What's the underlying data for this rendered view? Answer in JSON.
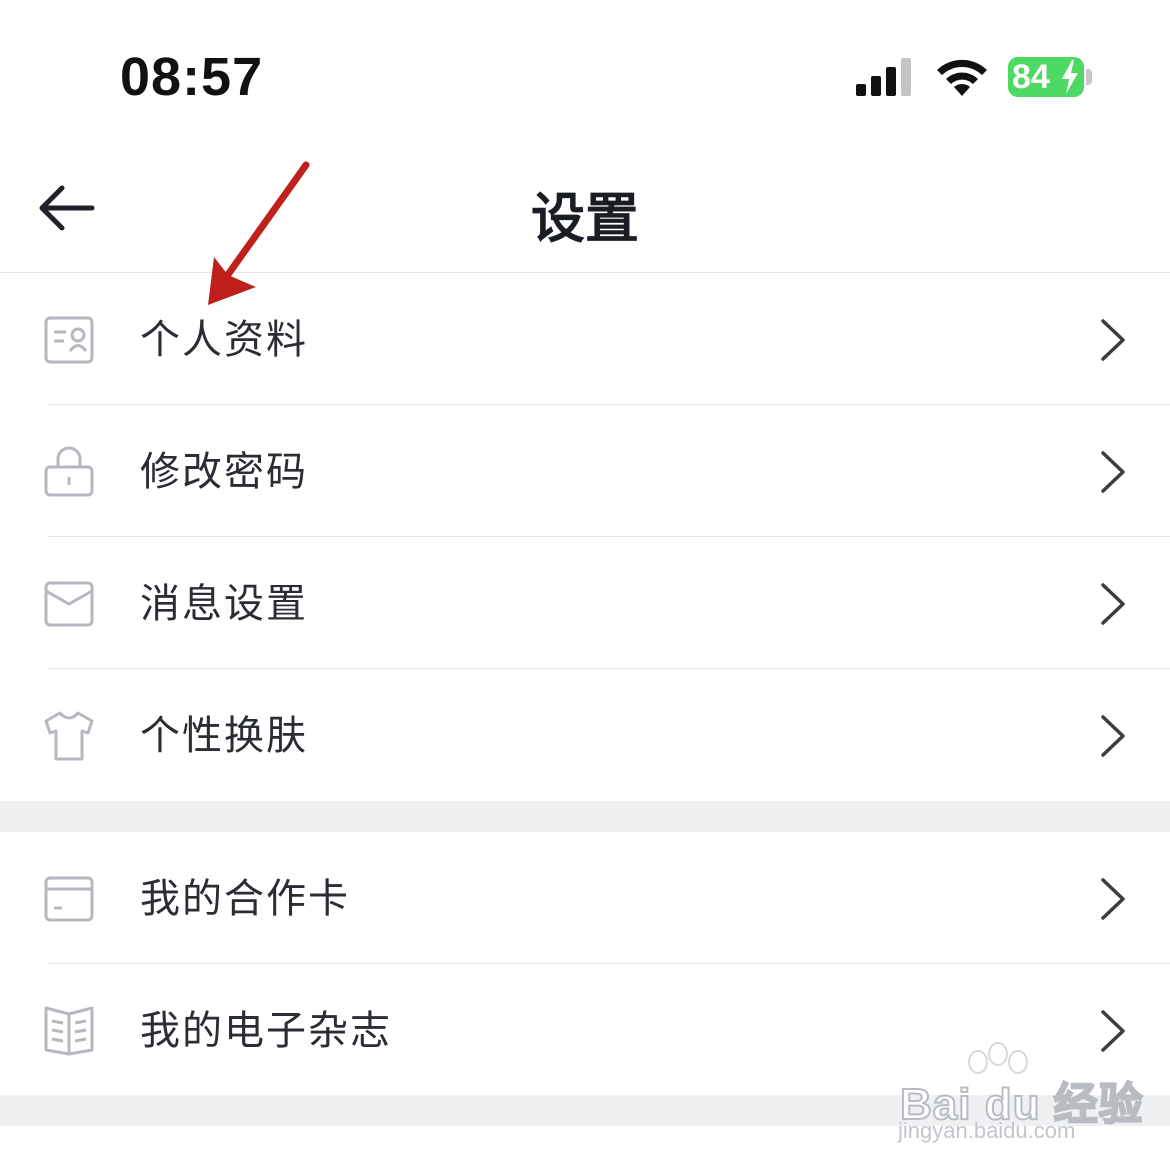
{
  "status_bar": {
    "time": "08:57",
    "battery_level": "84",
    "battery_color": "#4cd964",
    "icons": [
      "signal-icon",
      "wifi-icon",
      "battery-charging-icon"
    ]
  },
  "nav": {
    "title": "设置",
    "back_icon": "arrow-left-icon"
  },
  "groups": [
    {
      "items": [
        {
          "label": "个人资料",
          "icon": "id-card-icon"
        },
        {
          "label": "修改密码",
          "icon": "lock-icon"
        },
        {
          "label": "消息设置",
          "icon": "envelope-icon"
        },
        {
          "label": "个性换肤",
          "icon": "tshirt-icon"
        }
      ]
    },
    {
      "items": [
        {
          "label": "我的合作卡",
          "icon": "card-icon"
        },
        {
          "label": "我的电子杂志",
          "icon": "magazine-icon"
        }
      ]
    }
  ],
  "annotation": {
    "icon": "red-arrow-annotation",
    "color": "#c0201c"
  },
  "watermark": {
    "brand": "Bai du 经验",
    "url": "jingyan.baidu.com"
  },
  "colors": {
    "separator_bg": "#eef0f2",
    "text_primary": "#2a2d33",
    "icon_gray": "#b5b9bf"
  }
}
